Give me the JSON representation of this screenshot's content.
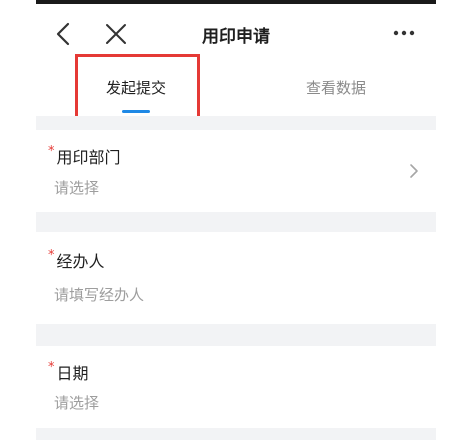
{
  "nav": {
    "title": "用印申请",
    "back_icon": "chevron-left-icon",
    "close_icon": "close-icon",
    "more_icon": "more-horizontal-icon"
  },
  "tabs": [
    {
      "label": "发起提交",
      "active": true
    },
    {
      "label": "查看数据",
      "active": false
    }
  ],
  "form": {
    "fields": [
      {
        "label": "用印部门",
        "required": true,
        "placeholder": "请选择",
        "has_chevron": true
      },
      {
        "label": "经办人",
        "required": true,
        "placeholder": "请填写经办人",
        "has_chevron": false
      },
      {
        "label": "日期",
        "required": true,
        "placeholder": "请选择",
        "has_chevron": false
      }
    ]
  },
  "required_marker": "*",
  "colors": {
    "accent": "#1e88e5",
    "required": "#e53935",
    "highlight": "#e53935",
    "separator": "#f2f3f5"
  }
}
